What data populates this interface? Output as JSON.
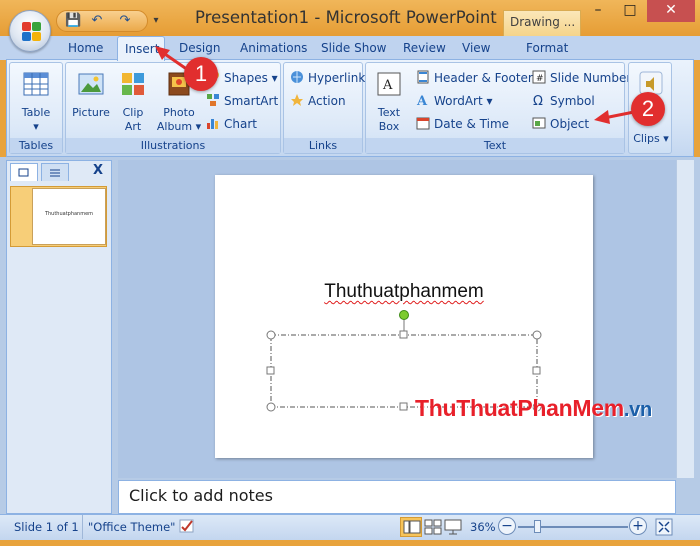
{
  "window": {
    "title": "Presentation1 - Microsoft PowerPoint",
    "contextual_tab_group": "Drawing ...",
    "controls": {
      "minimize": "–",
      "maximize": "□",
      "close": "✕"
    }
  },
  "quick_access": {
    "save": "💾",
    "undo": "↶",
    "redo": "↷",
    "more": "▾"
  },
  "tabs": [
    {
      "label": "Home"
    },
    {
      "label": "Insert"
    },
    {
      "label": "Design"
    },
    {
      "label": "Animations"
    },
    {
      "label": "Slide Show"
    },
    {
      "label": "Review"
    },
    {
      "label": "View"
    },
    {
      "label": "Format"
    }
  ],
  "ribbon": {
    "groups": {
      "tables": "Tables",
      "illustrations": "Illustrations",
      "links": "Links",
      "text": "Text"
    },
    "table": {
      "label": "Table",
      "arrow": "▾"
    },
    "picture": {
      "label": "Picture"
    },
    "clipart": {
      "label1": "Clip",
      "label2": "Art"
    },
    "photo_album": {
      "label1": "Photo",
      "label2": "Album ▾"
    },
    "shapes": "Shapes ▾",
    "smartart": "SmartArt",
    "chart": "Chart",
    "hyperlink": "Hyperlink",
    "action": "Action",
    "text_box": {
      "label1": "Text",
      "label2": "Box"
    },
    "header_footer": "Header & Footer",
    "wordart": "WordArt ▾",
    "date_time": "Date & Time",
    "slide_number": "Slide Number",
    "symbol": "Symbol",
    "object": "Object",
    "clips": "Clips ▾"
  },
  "callouts": {
    "one": "1",
    "two": "2"
  },
  "left_pane": {
    "close": "X",
    "slide_number": "1",
    "thumb_text": "Thuthuatphanmem"
  },
  "slide": {
    "title_text": "Thuthuatphanmem"
  },
  "notes": {
    "placeholder": "Click to add notes"
  },
  "status": {
    "slide_info": "Slide 1 of 1",
    "theme": "\"Office Theme\"",
    "zoom": "36%",
    "zoom_minus": "−",
    "zoom_plus": "+"
  },
  "watermark": {
    "part1": "Thu",
    "part2": "Thuat",
    "part3": "Phan",
    "part4": "Mem",
    "part5": ".vn"
  },
  "colors": {
    "accent": "#15428b",
    "callout": "#e12e2e",
    "watermark_red": "#e8202a",
    "watermark_blue": "#1b5fa8"
  }
}
